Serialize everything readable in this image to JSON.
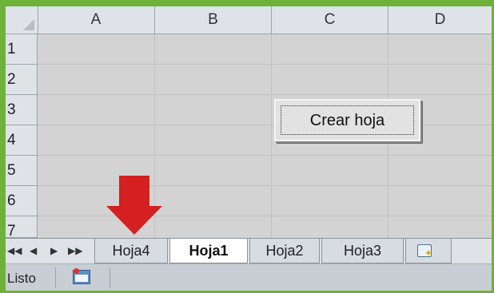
{
  "columns": [
    "A",
    "B",
    "C",
    "D"
  ],
  "rows": [
    "1",
    "2",
    "3",
    "4",
    "5",
    "6",
    "7"
  ],
  "button": {
    "label": "Crear hoja"
  },
  "sheet_nav": [
    "◀◀",
    "◀",
    "▶",
    "▶▶"
  ],
  "sheet_tabs": [
    {
      "label": "Hoja4",
      "active": false
    },
    {
      "label": "Hoja1",
      "active": true
    },
    {
      "label": "Hoja2",
      "active": false
    },
    {
      "label": "Hoja3",
      "active": false
    }
  ],
  "status": {
    "text": "Listo"
  },
  "icons": {
    "new_sheet": "insert-worksheet-icon",
    "macro": "record-macro-icon",
    "annotation": "red-down-arrow"
  },
  "colors": {
    "background": "#6fb23a",
    "arrow": "#d42020"
  }
}
